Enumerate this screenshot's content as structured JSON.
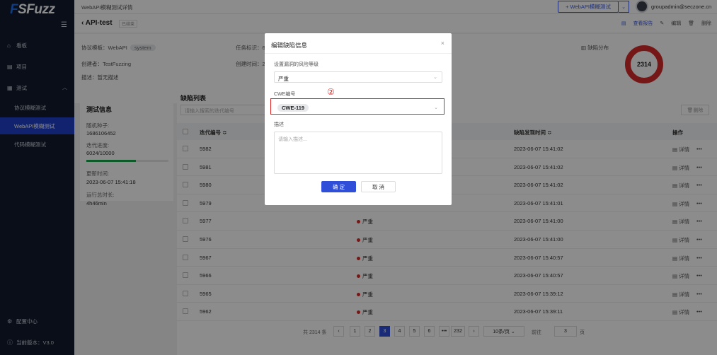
{
  "app": {
    "logo": "SFuzz"
  },
  "sidebar": {
    "items": [
      {
        "label": "看板",
        "icon": "home-icon"
      },
      {
        "label": "项目",
        "icon": "folder-icon"
      },
      {
        "label": "测试",
        "icon": "test-icon"
      },
      {
        "label": "协议模糊测试"
      },
      {
        "label": "WebAPI模糊测试"
      },
      {
        "label": "代码模糊测试"
      }
    ],
    "config": "配置中心",
    "version": "当前版本：V3.0"
  },
  "topbar": {
    "breadcrumb": "WebAPI模糊测试详情",
    "new_button": "+  WebAPI模糊测试",
    "user": "groupadmin@seczone.cn"
  },
  "page": {
    "title": "API-test",
    "tag": "已结束",
    "actions": {
      "report": "查看报告",
      "edit": "编辑",
      "delete": "删除"
    }
  },
  "info": {
    "template_label": "协议模板：",
    "template_value": "WebAPI",
    "template_tag": "system",
    "creator_label": "创建者：",
    "creator_value": "TestFuzzing",
    "desc_label": "描述：",
    "desc_value": "暂无描述",
    "task_label": "任务标识：6",
    "created_label": "创建时间：2",
    "dist_label": "缺陷分布",
    "total": "2314"
  },
  "test_info": {
    "title": "测试信息",
    "seed_label": "随机种子:",
    "seed_value": "1686106452",
    "progress_label": "迭代进度:",
    "progress_value": "6024/10000",
    "progress_fraction": 0.6024,
    "updated_label": "更新时间:",
    "updated_value": "2023-06-07 15:41:18",
    "runtime_label": "运行总时长:",
    "runtime_value": "4h46min"
  },
  "list": {
    "title": "缺陷列表",
    "search_placeholder": "请输入搜索的迭代编号",
    "delete": "删除",
    "columns": {
      "id": "迭代编号 ≎",
      "time": "缺陷发现时间 ≎",
      "op": "操作"
    },
    "rows": [
      {
        "id": "5982",
        "level": "",
        "time": "2023-06-07 15:41:02"
      },
      {
        "id": "5981",
        "level": "",
        "time": "2023-06-07 15:41:02"
      },
      {
        "id": "5980",
        "level": "",
        "time": "2023-06-07 15:41:02"
      },
      {
        "id": "5979",
        "level": "",
        "time": "2023-06-07 15:41:01"
      },
      {
        "id": "5977",
        "level": "严重",
        "time": "2023-06-07 15:41:00"
      },
      {
        "id": "5976",
        "level": "严重",
        "time": "2023-06-07 15:41:00"
      },
      {
        "id": "5967",
        "level": "严重",
        "time": "2023-06-07 15:40:57"
      },
      {
        "id": "5966",
        "level": "严重",
        "time": "2023-06-07 15:40:57"
      },
      {
        "id": "5965",
        "level": "严重",
        "time": "2023-06-07 15:39:12"
      },
      {
        "id": "5962",
        "level": "严重",
        "time": "2023-06-07 15:39:11"
      }
    ],
    "detail": "详情",
    "more": "•••"
  },
  "pager": {
    "total": "共 2314 条",
    "pages": [
      "1",
      "2",
      "3",
      "4",
      "5",
      "6",
      "•••",
      "232"
    ],
    "current": "3",
    "per_page": "10条/页",
    "goto_label": "前往",
    "goto_value": "3",
    "page_unit": "页"
  },
  "modal": {
    "title": "编辑缺陷信息",
    "risk_label": "设置漏洞的风险等级",
    "risk_value": "严重",
    "cwe_label": "CWE编号",
    "cwe_value": "CWE-119",
    "annotation": "②",
    "desc_label": "描述",
    "desc_placeholder": "请输入描述...",
    "ok": "确 定",
    "cancel": "取 消"
  }
}
